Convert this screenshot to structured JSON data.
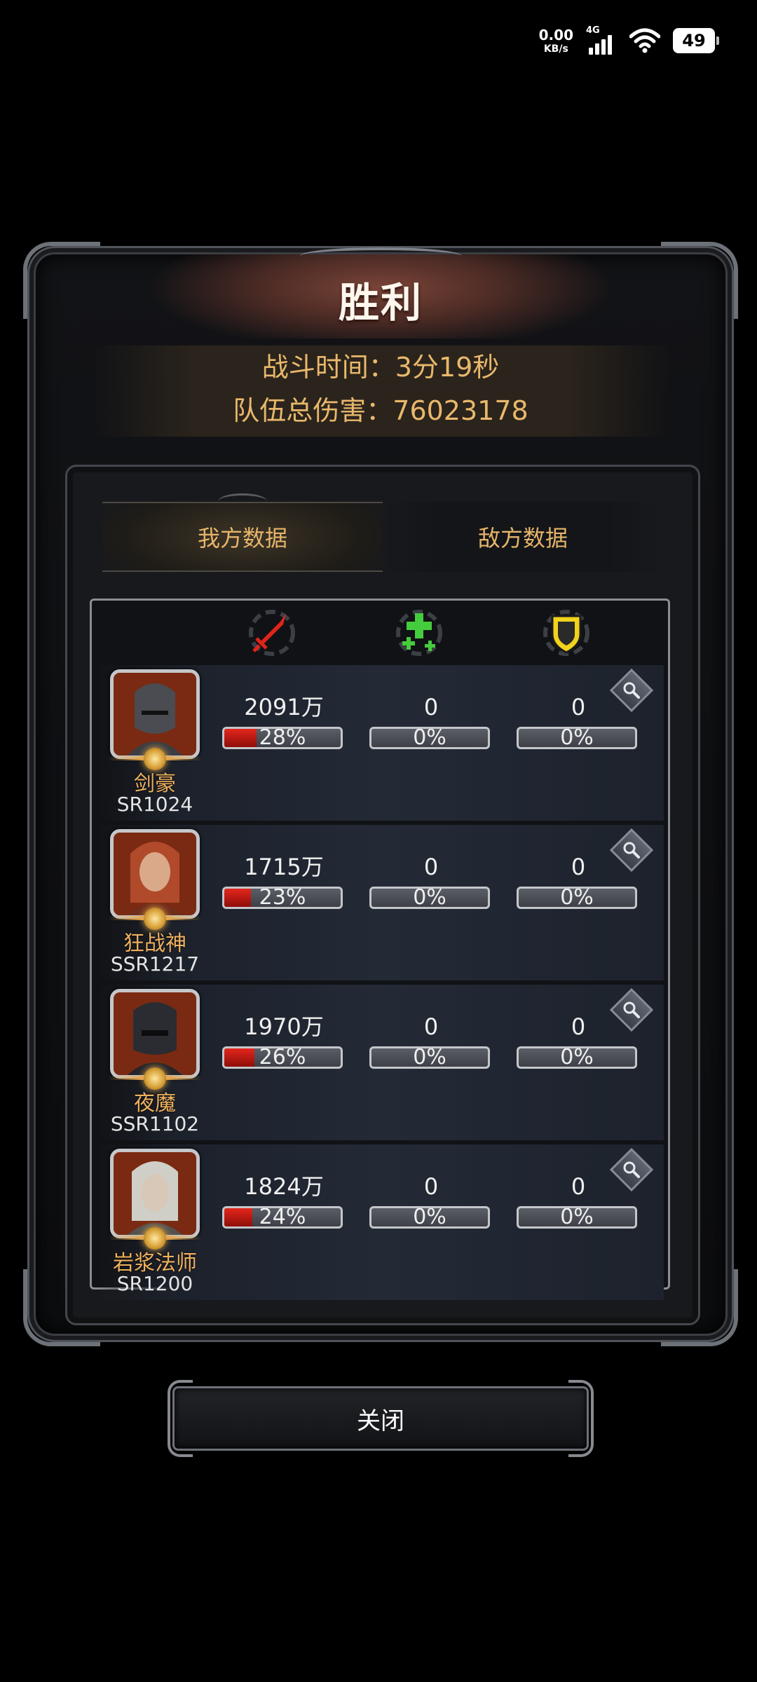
{
  "status_bar": {
    "net_speed_value": "0.00",
    "net_speed_unit": "KB/s",
    "network_type": "4G",
    "battery_level": "49"
  },
  "result": {
    "title": "胜利",
    "battle_time": "战斗时间：3分19秒",
    "team_damage": "队伍总伤害：76023178"
  },
  "tabs": {
    "ours": "我方数据",
    "enemy": "敌方数据"
  },
  "stat_icons": [
    "sword-icon",
    "heal-cross-icon",
    "shield-icon"
  ],
  "colors": {
    "accent_gold": "#e6b56a",
    "damage_red": "#e3261d",
    "heal_green": "#4ad14a",
    "shield_yellow": "#f2d21b"
  },
  "heroes": [
    {
      "name": "剑豪",
      "rank": "SR1024",
      "damage": "2091万",
      "damage_pct": "28%",
      "damage_fraction": 0.28,
      "heal": "0",
      "heal_pct": "0%",
      "heal_fraction": 0,
      "defense": "0",
      "defense_pct": "0%",
      "defense_fraction": 0
    },
    {
      "name": "狂战神",
      "rank": "SSR1217",
      "damage": "1715万",
      "damage_pct": "23%",
      "damage_fraction": 0.23,
      "heal": "0",
      "heal_pct": "0%",
      "heal_fraction": 0,
      "defense": "0",
      "defense_pct": "0%",
      "defense_fraction": 0
    },
    {
      "name": "夜魔",
      "rank": "SSR1102",
      "damage": "1970万",
      "damage_pct": "26%",
      "damage_fraction": 0.26,
      "heal": "0",
      "heal_pct": "0%",
      "heal_fraction": 0,
      "defense": "0",
      "defense_pct": "0%",
      "defense_fraction": 0
    },
    {
      "name": "岩浆法师",
      "rank": "SR1200",
      "damage": "1824万",
      "damage_pct": "24%",
      "damage_fraction": 0.24,
      "heal": "0",
      "heal_pct": "0%",
      "heal_fraction": 0,
      "defense": "0",
      "defense_pct": "0%",
      "defense_fraction": 0
    }
  ],
  "close_button": "关闭"
}
